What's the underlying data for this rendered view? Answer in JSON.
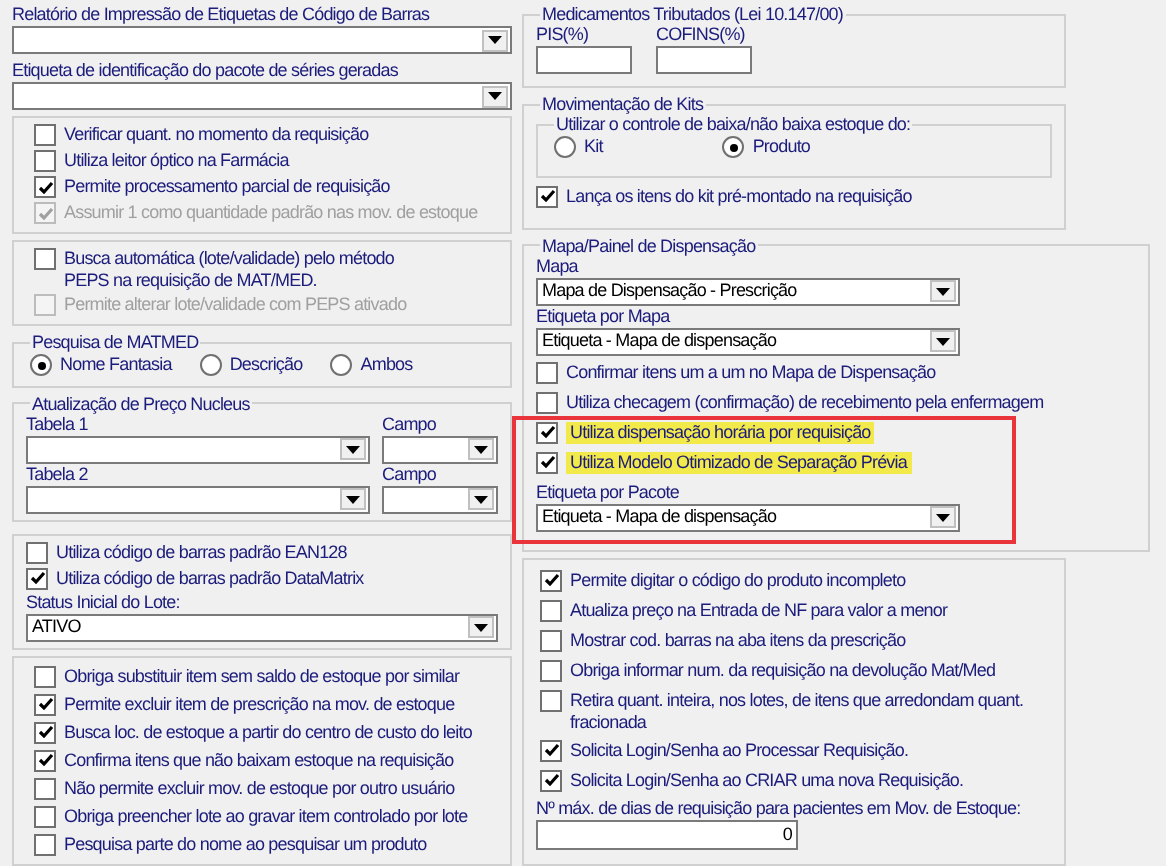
{
  "barcode_report": {
    "label": "Relatório de Impressão de Etiquetas de Código de Barras"
  },
  "package_label": {
    "label": "Etiqueta de identificação do pacote de séries geradas"
  },
  "requisition_options": [
    {
      "label": "Verificar quant. no momento da requisição",
      "checked": false,
      "disabled": false
    },
    {
      "label": "Utiliza leitor óptico na Farmácia",
      "checked": false,
      "disabled": false
    },
    {
      "label": "Permite processamento parcial de requisição",
      "checked": true,
      "disabled": false
    },
    {
      "label": "Assumir 1 como quantidade padrão nas mov. de estoque",
      "checked": true,
      "disabled": true
    }
  ],
  "peps_options": [
    {
      "label": "Busca automática (lote/validade) pelo método PEPS na requisição de MAT/MED.",
      "checked": false,
      "disabled": false
    },
    {
      "label": "Permite alterar lote/validade com PEPS ativado",
      "checked": false,
      "disabled": true
    }
  ],
  "matmed_search": {
    "title": "Pesquisa de MATMED",
    "options": [
      {
        "label": "Nome Fantasia",
        "selected": true
      },
      {
        "label": "Descrição",
        "selected": false
      },
      {
        "label": "Ambos",
        "selected": false
      }
    ]
  },
  "nucleus_price": {
    "title": "Atualização de Preço Nucleus",
    "rows": [
      {
        "table": "Tabela 1",
        "field": "Campo"
      },
      {
        "table": "Tabela 2",
        "field": "Campo"
      }
    ]
  },
  "barcode_options": [
    {
      "label": "Utiliza código de barras padrão EAN128",
      "checked": false,
      "disabled": false
    },
    {
      "label": "Utiliza código de barras padrão DataMatrix",
      "checked": true,
      "disabled": false
    }
  ],
  "lot_status": {
    "label": "Status Inicial do Lote:",
    "value": "ATIVO"
  },
  "stock_options": [
    {
      "label": "Obriga substituir item sem saldo de estoque por similar",
      "checked": false,
      "disabled": false
    },
    {
      "label": "Permite excluir item de prescrição na mov. de estoque",
      "checked": true,
      "disabled": false
    },
    {
      "label": "Busca loc. de estoque a partir do centro de custo do leito",
      "checked": true,
      "disabled": false
    },
    {
      "label": "Confirma itens que não baixam estoque na requisição",
      "checked": true,
      "disabled": false
    },
    {
      "label": "Não permite excluir mov. de estoque por outro usuário",
      "checked": false,
      "disabled": false
    },
    {
      "label": "Obriga preencher lote ao gravar item controlado por lote",
      "checked": false,
      "disabled": false
    },
    {
      "label": "Pesquisa parte do nome ao pesquisar um produto",
      "checked": false,
      "disabled": false
    }
  ],
  "taxed_drugs": {
    "title": "Medicamentos Tributados (Lei 10.147/00)",
    "fields": [
      {
        "label": "PIS(%)"
      },
      {
        "label": "COFINS(%)"
      }
    ]
  },
  "kits": {
    "title": "Movimentação de Kits",
    "control_title": "Utilizar o controle de baixa/não baixa estoque do:",
    "options": [
      {
        "label": "Kit",
        "selected": false
      },
      {
        "label": "Produto",
        "selected": true
      }
    ],
    "option": {
      "label": "Lança os itens do kit pré-montado na requisição",
      "checked": true,
      "disabled": false
    }
  },
  "dispensing": {
    "title": "Mapa/Painel de Dispensação",
    "map": {
      "label": "Mapa",
      "value": "Mapa de Dispensação - Prescrição"
    },
    "map_label": {
      "label": "Etiqueta por Mapa",
      "value": "Etiqueta - Mapa de dispensação"
    },
    "options": [
      {
        "label": "Confirmar itens um a um no Mapa de Dispensação",
        "checked": false,
        "disabled": false,
        "highlighted": false
      },
      {
        "label": "Utiliza checagem (confirmação) de recebimento pela enfermagem",
        "checked": false,
        "disabled": false,
        "highlighted": false
      },
      {
        "label": "Utiliza dispensação horária por requisição",
        "checked": true,
        "disabled": false,
        "highlighted": true
      },
      {
        "label": "Utiliza Modelo Otimizado de Separação Prévia",
        "checked": true,
        "disabled": false,
        "highlighted": true
      }
    ],
    "package_label": {
      "label": "Etiqueta por Pacote",
      "value": "Etiqueta - Mapa de dispensação"
    }
  },
  "general_options": [
    {
      "label": "Permite digitar o código do produto incompleto",
      "checked": true,
      "disabled": false
    },
    {
      "label": "Atualiza preço na Entrada de NF para valor a menor",
      "checked": false,
      "disabled": false
    },
    {
      "label": "Mostrar cod. barras na aba itens da prescrição",
      "checked": false,
      "disabled": false
    },
    {
      "label": "Obriga informar num. da requisição na devolução Mat/Med",
      "checked": false,
      "disabled": false
    },
    {
      "label": "Retira quant. inteira, nos lotes, de itens que arredondam quant. fracionada",
      "checked": false,
      "disabled": false
    },
    {
      "label": "Solicita Login/Senha ao Processar Requisição.",
      "checked": true,
      "disabled": false
    },
    {
      "label": "Solicita Login/Senha ao CRIAR uma nova Requisição.",
      "checked": true,
      "disabled": false
    }
  ],
  "max_days": {
    "label": "Nº máx. de dias de requisição para pacientes em Mov. de Estoque:",
    "value": "0"
  }
}
